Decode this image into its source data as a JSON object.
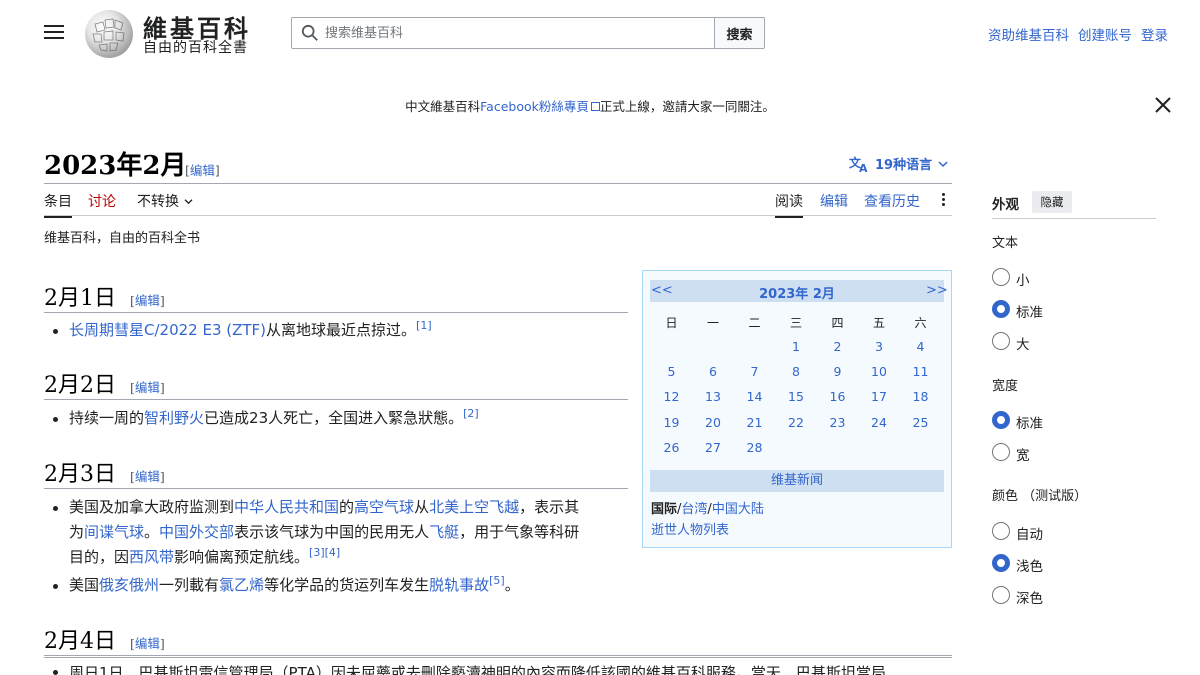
{
  "header": {
    "wordmark": "維基百科",
    "tagline": "自由的百科全書",
    "search_placeholder": "搜索维基百科",
    "search_button": "搜索",
    "links": [
      "资助维基百科",
      "创建账号",
      "登录"
    ]
  },
  "banner": {
    "prefix": "中文維基百科",
    "link": "Facebook粉絲專頁",
    "suffix": "正式上線，邀請大家一同關注。"
  },
  "page": {
    "title": "2023年2月",
    "edit_label": "编辑",
    "languages": "19种语言",
    "tabs_left": [
      "条目",
      "讨论",
      "不转换"
    ],
    "tabs_right": [
      "阅读",
      "编辑",
      "查看历史"
    ],
    "subtitle": "维基百科，自由的百科全书"
  },
  "sections": [
    {
      "heading": "2月1日",
      "items": [
        {
          "parts": [
            {
              "t": "长周期彗星C/2022 E3 (ZTF)",
              "link": true
            },
            {
              "t": "从离地球最近点掠过。"
            },
            {
              "t": "[1]",
              "sup": true
            }
          ]
        }
      ]
    },
    {
      "heading": "2月2日",
      "items": [
        {
          "parts": [
            {
              "t": "持续一周的"
            },
            {
              "t": "智利野火",
              "link": true
            },
            {
              "t": "已造成23人死亡，全国进入緊急狀態。"
            },
            {
              "t": "[2]",
              "sup": true
            }
          ]
        }
      ]
    },
    {
      "heading": "2月3日",
      "items": [
        {
          "lines": [
            [
              {
                "t": "美国及加拿大政府监测到"
              },
              {
                "t": "中华人民共和国",
                "link": true
              },
              {
                "t": "的"
              },
              {
                "t": "高空气球",
                "link": true
              },
              {
                "t": "从"
              },
              {
                "t": "北美上空飞越",
                "link": true
              },
              {
                "t": "，表示其"
              }
            ],
            [
              {
                "t": "为"
              },
              {
                "t": "间谍气球",
                "link": true
              },
              {
                "t": "。"
              },
              {
                "t": "中国外交部",
                "link": true
              },
              {
                "t": "表示该气球为中国的民用无人"
              },
              {
                "t": "飞艇",
                "link": true
              },
              {
                "t": "，用于气象等科研"
              }
            ],
            [
              {
                "t": "目的，因"
              },
              {
                "t": "西风带",
                "link": true
              },
              {
                "t": "影响偏离预定航线。"
              },
              {
                "t": "[3][4]",
                "sup": true
              }
            ]
          ]
        },
        {
          "parts": [
            {
              "t": "美国"
            },
            {
              "t": "俄亥俄州",
              "link": true
            },
            {
              "t": "一列載有"
            },
            {
              "t": "氯乙烯",
              "link": true
            },
            {
              "t": "等化学品的货运列车发生"
            },
            {
              "t": "脱轨事故",
              "link": true
            },
            {
              "t": "[5]",
              "sup": true
            },
            {
              "t": "。"
            }
          ]
        }
      ]
    },
    {
      "heading": "2月4日",
      "items": []
    }
  ],
  "calendar": {
    "prev": "<<",
    "next": ">>",
    "title": "2023年 2月",
    "weekdays": [
      "日",
      "一",
      "二",
      "三",
      "四",
      "五",
      "六"
    ],
    "weeks": [
      [
        "",
        "",
        "",
        "1",
        "2",
        "3",
        "4"
      ],
      [
        "5",
        "6",
        "7",
        "8",
        "9",
        "10",
        "11"
      ],
      [
        "12",
        "13",
        "14",
        "15",
        "16",
        "17",
        "18"
      ],
      [
        "19",
        "20",
        "21",
        "22",
        "23",
        "24",
        "25"
      ],
      [
        "26",
        "27",
        "28",
        "",
        "",
        "",
        ""
      ]
    ],
    "news_title": "维基新闻",
    "news_intl": "国际",
    "news_tw": "台湾",
    "news_cn": "中国大陆",
    "deaths": "逝世人物列表"
  },
  "appearance": {
    "title": "外观",
    "hide": "隐藏",
    "text_label": "文本",
    "text_options": [
      "小",
      "标准",
      "大"
    ],
    "text_selected": 1,
    "width_label": "宽度",
    "width_options": [
      "标准",
      "宽"
    ],
    "width_selected": 0,
    "color_label": "颜色 （测试版）",
    "color_options": [
      "自动",
      "浅色",
      "深色"
    ],
    "color_selected": 1
  },
  "cut_line": "周日1日，巴基斯坦電信管理局（PTA）因未屈藥或去刪除褻瀆神明的內容而降低該國的維基百科服務。當天，巴基斯坦當局"
}
